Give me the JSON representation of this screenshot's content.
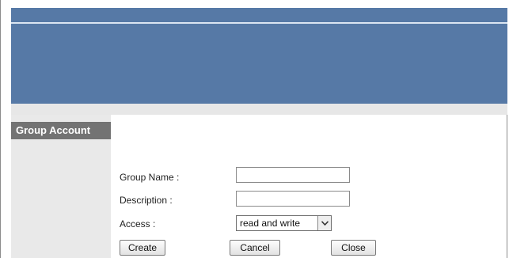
{
  "sidebar": {
    "heading": "Group Account"
  },
  "form": {
    "group_name": {
      "label": "Group Name :",
      "value": ""
    },
    "description": {
      "label": "Description :",
      "value": ""
    },
    "access": {
      "label": "Access :",
      "selected": "read and write",
      "arrow_icon": "chevron-down-icon"
    }
  },
  "buttons": {
    "create": "Create",
    "cancel": "Cancel",
    "close": "Close"
  },
  "colors": {
    "header_blue": "#5679a6",
    "header_line": "#dce6f2",
    "sidebar_bg": "#e9e9e9",
    "sidebar_heading_bg": "#737373"
  }
}
